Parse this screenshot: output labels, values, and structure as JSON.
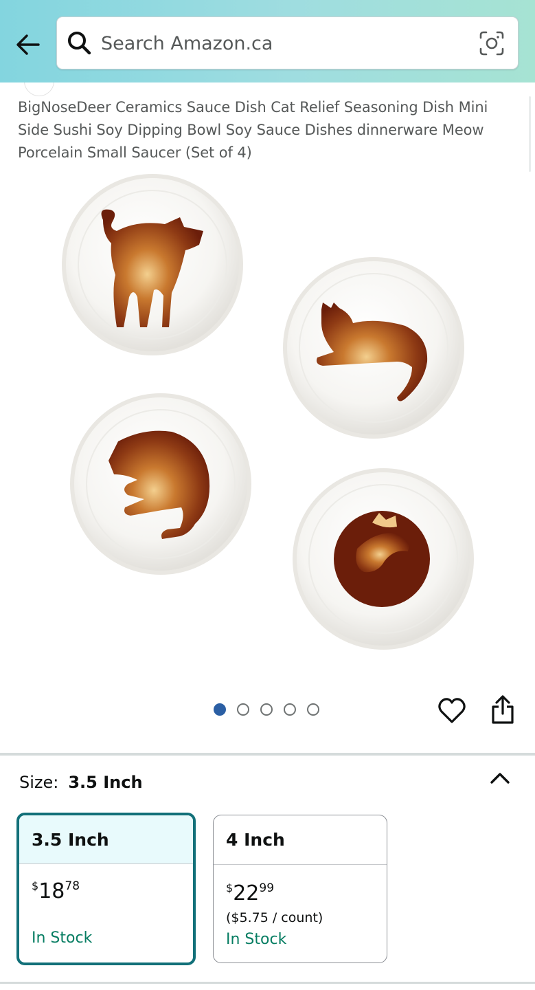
{
  "search": {
    "placeholder": "Search Amazon.ca"
  },
  "product": {
    "title": "BigNoseDeer Ceramics Sauce Dish Cat Relief Seasoning Dish Mini Side Sushi Soy Dipping Bowl Soy Sauce Dishes dinnerware Meow Porcelain Small Saucer (Set of 4)",
    "image_alt": "Four white ceramic sauce dishes with brown cat silhouettes",
    "image_pager": {
      "total": 5,
      "active_index": 0
    }
  },
  "size": {
    "label": "Size:",
    "selected": "3.5 Inch",
    "options": [
      {
        "name": "3.5 Inch",
        "currency": "$",
        "whole": "18",
        "fraction": "78",
        "unit_price": "",
        "stock": "In Stock",
        "selected": true
      },
      {
        "name": "4 Inch",
        "currency": "$",
        "whole": "22",
        "fraction": "99",
        "unit_price": "($5.75 / count)",
        "stock": "In Stock",
        "selected": false
      }
    ]
  },
  "colors": {
    "header_start": "#83d5df",
    "header_end": "#a6e3d3",
    "selected_border": "#127079",
    "selected_head_bg": "#e8fafc",
    "in_stock": "#067d62",
    "pager_active": "#2b5fa4"
  },
  "icons": {
    "back": "arrow-left-icon",
    "search": "search-icon",
    "lens": "camera-lens-icon",
    "wishlist": "heart-icon",
    "share": "share-icon",
    "collapse": "chevron-up-icon"
  }
}
